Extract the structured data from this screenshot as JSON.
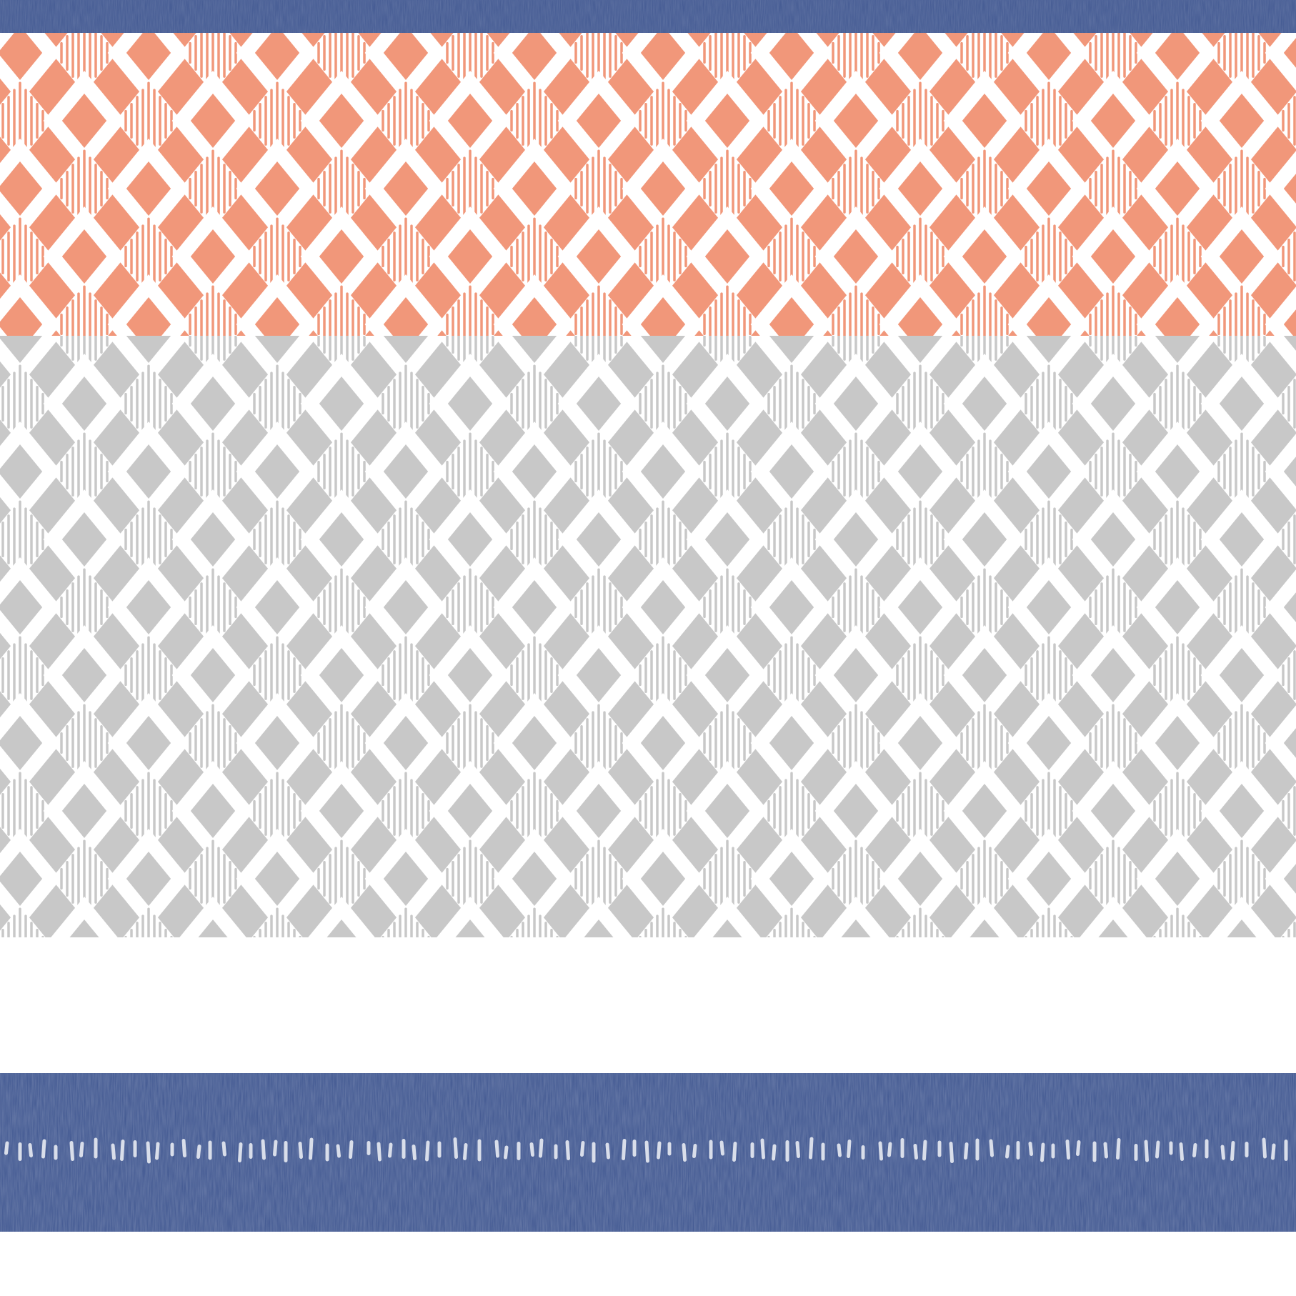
{
  "pattern": {
    "name": "ikat-diamond-stripe-print",
    "colors": {
      "navy": "#3f5690",
      "navy_texture": "#5a6fa6",
      "coral": "#f1977a",
      "gray": "#c8c8c8",
      "white": "#ffffff",
      "dash": "#d9deea"
    },
    "bands": [
      "navy-stripe",
      "coral-ikat",
      "gray-ikat",
      "white-gap",
      "navy-dash-stripe",
      "white-border"
    ]
  }
}
